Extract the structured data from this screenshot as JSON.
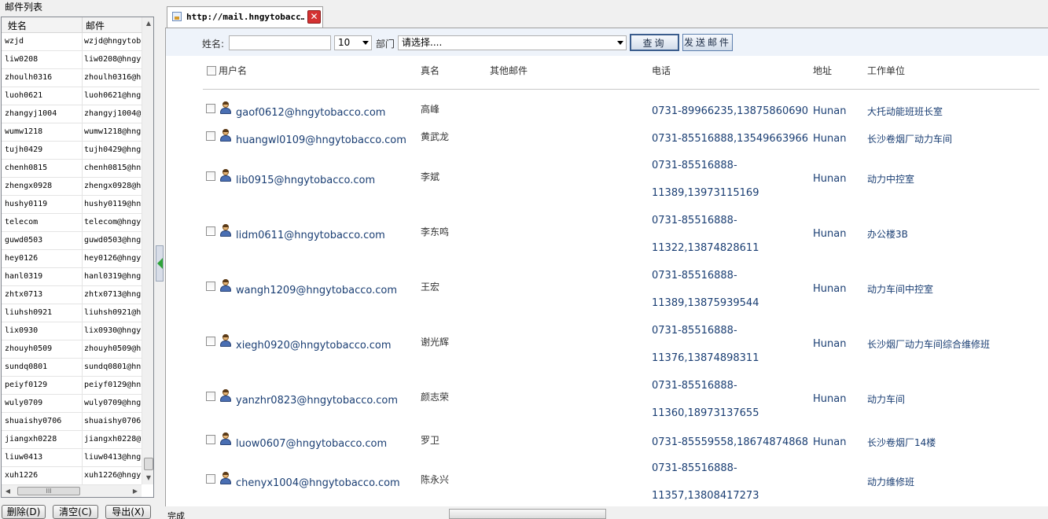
{
  "left_panel": {
    "title": "邮件列表",
    "columns": [
      "姓名",
      "邮件"
    ],
    "rows": [
      {
        "name": "wzjd",
        "email": "wzjd@hngytob"
      },
      {
        "name": "liw0208",
        "email": "liw0208@hngy"
      },
      {
        "name": "zhoulh0316",
        "email": "zhoulh0316@h"
      },
      {
        "name": "luoh0621",
        "email": "luoh0621@hng"
      },
      {
        "name": "zhangyj1004",
        "email": "zhangyj1004@"
      },
      {
        "name": "wumw1218",
        "email": "wumw1218@hng"
      },
      {
        "name": "tujh0429",
        "email": "tujh0429@hng"
      },
      {
        "name": "chenh0815",
        "email": "chenh0815@hn"
      },
      {
        "name": "zhengx0928",
        "email": "zhengx0928@h"
      },
      {
        "name": "hushy0119",
        "email": "hushy0119@hn"
      },
      {
        "name": "telecom",
        "email": "telecom@hngy"
      },
      {
        "name": "guwd0503",
        "email": "guwd0503@hng"
      },
      {
        "name": "hey0126",
        "email": "hey0126@hngy"
      },
      {
        "name": "hanl0319",
        "email": "hanl0319@hng"
      },
      {
        "name": "zhtx0713",
        "email": "zhtx0713@hng"
      },
      {
        "name": "liuhsh0921",
        "email": "liuhsh0921@h"
      },
      {
        "name": "lix0930",
        "email": "lix0930@hngy"
      },
      {
        "name": "zhouyh0509",
        "email": "zhouyh0509@h"
      },
      {
        "name": "sundq0801",
        "email": "sundq0801@hn"
      },
      {
        "name": "peiyf0129",
        "email": "peiyf0129@hn"
      },
      {
        "name": "wuly0709",
        "email": "wuly0709@hng"
      },
      {
        "name": "shuaishy0706",
        "email": "shuaishy0706"
      },
      {
        "name": "jiangxh0228",
        "email": "jiangxh0228@"
      },
      {
        "name": "liuw0413",
        "email": "liuw0413@hng"
      },
      {
        "name": "xuh1226",
        "email": "xuh1226@hngy"
      }
    ],
    "buttons": {
      "delete": "删除(D)",
      "clear": "清空(C)",
      "export": "导出(X)"
    },
    "hscroll_thumb": "III"
  },
  "tab": {
    "title": "http://mail.hngytobacc…",
    "close": "✕"
  },
  "filter": {
    "name_label": "姓名:",
    "name_value": "",
    "page_size": "10",
    "dept_label": "部门",
    "dept_value": "请选择....",
    "query_button": "查询",
    "send_button": "发送邮件"
  },
  "table": {
    "headers": {
      "username": "用户名",
      "realname": "真名",
      "other_email": "其他邮件",
      "phone": "电话",
      "address": "地址",
      "unit": "工作单位"
    },
    "rows": [
      {
        "email": "gaof0612@hngytobacco.com",
        "realname": "高峰",
        "phone1": "0731-89966235,13875860690",
        "phone2": "",
        "addr": "Hunan",
        "unit": "大托动能班班长室"
      },
      {
        "email": "huangwl0109@hngytobacco.com",
        "realname": "黄武龙",
        "phone1": "0731-85516888,13549663966",
        "phone2": "",
        "addr": "Hunan",
        "unit": "长沙卷烟厂动力车间"
      },
      {
        "email": "lib0915@hngytobacco.com",
        "realname": "李斌",
        "phone1": "0731-85516888-",
        "phone2": "11389,13973115169",
        "addr": "Hunan",
        "unit": "动力中控室"
      },
      {
        "email": "lidm0611@hngytobacco.com",
        "realname": "李东鸣",
        "phone1": "0731-85516888-",
        "phone2": "11322,13874828611",
        "addr": "Hunan",
        "unit": "办公楼3B"
      },
      {
        "email": "wangh1209@hngytobacco.com",
        "realname": "王宏",
        "phone1": "0731-85516888-",
        "phone2": "11389,13875939544",
        "addr": "Hunan",
        "unit": "动力车间中控室"
      },
      {
        "email": "xiegh0920@hngytobacco.com",
        "realname": "谢光辉",
        "phone1": "0731-85516888-",
        "phone2": "11376,13874898311",
        "addr": "Hunan",
        "unit": "长沙烟厂动力车间综合维修班"
      },
      {
        "email": "yanzhr0823@hngytobacco.com",
        "realname": "颜志荣",
        "phone1": "0731-85516888-",
        "phone2": "11360,18973137655",
        "addr": "Hunan",
        "unit": "动力车间"
      },
      {
        "email": "luow0607@hngytobacco.com",
        "realname": "罗卫",
        "phone1": "0731-85559558,18674874868",
        "phone2": "",
        "addr": "Hunan",
        "unit": "长沙卷烟厂14楼"
      },
      {
        "email": "chenyx1004@hngytobacco.com",
        "realname": "陈永兴",
        "phone1": "0731-85516888-",
        "phone2": "11357,13808417273",
        "addr": "",
        "unit": "动力维修班"
      }
    ]
  },
  "status": {
    "text": "完成"
  }
}
